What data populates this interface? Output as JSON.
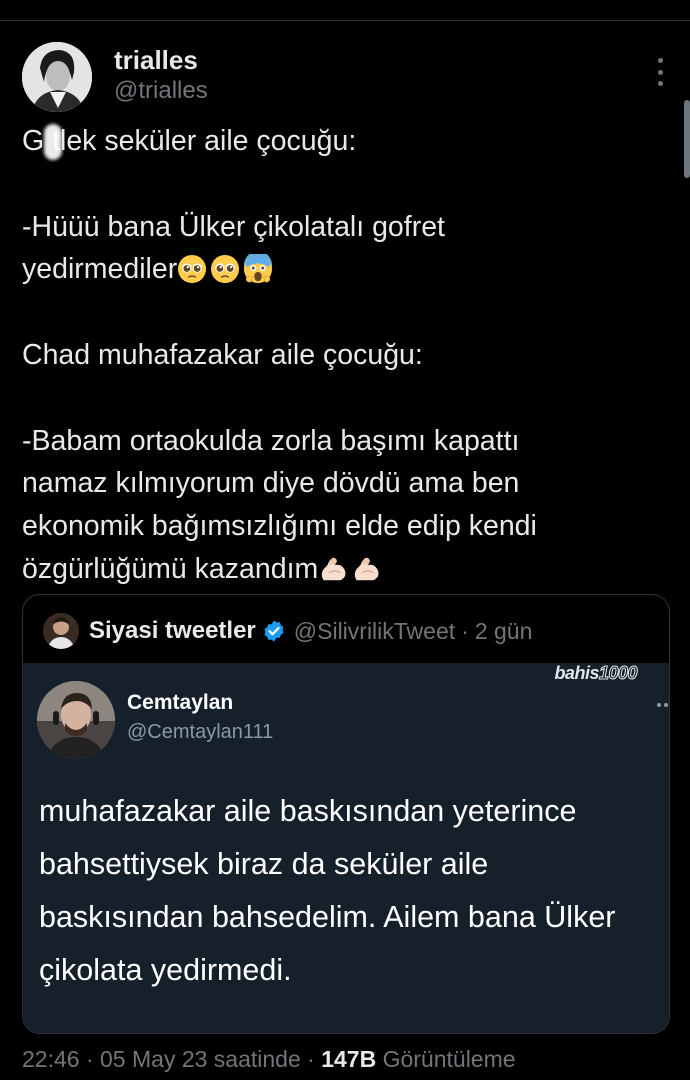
{
  "author": {
    "display_name": "trialles",
    "handle": "@trialles",
    "avatar": "avatar-photo"
  },
  "tweet": {
    "text_line1": "G  tlek seküler aile çocuğu:",
    "text_block2": "-Hüüü bana Ülker çikolatalı gofret\nyedirmediler",
    "emoji_after_block2": [
      "pleading-face-emoji",
      "pleading-face-emoji",
      "screaming-face-emoji"
    ],
    "text_line3": "Chad muhafazakar aile çocuğu:",
    "text_block4": "-Babam ortaokulda zorla başımı kapattı\nnamaz kılmıyorum diye dövdü ama ben\nekonomik bağımsızlığımı elde edip kendi\nözgürlüğümü kazandım",
    "emoji_after_block4": [
      "flexed-biceps-emoji",
      "flexed-biceps-emoji"
    ]
  },
  "quote": {
    "display_name": "Siyasi tweetler",
    "verified_icon": "verified-badge-icon",
    "handle": "@SilivrilikTweet",
    "separator": "·",
    "age": "2 gün",
    "screenshot": {
      "watermark_text": "bahis",
      "watermark_num": "1000",
      "name": "Cemtaylan",
      "handle": "@Cemtaylan111",
      "text": "muhafazakar aile baskısından yeterince\nbahsettiysek biraz da seküler aile\nbaskısından bahsedelim. Ailem bana Ülker\nçikolata yedirmedi."
    }
  },
  "footer": {
    "time": "22:46",
    "sep1": "·",
    "date": "05 May 23 saatinde",
    "sep2": "·",
    "views_count": "147B",
    "views_label": "Görüntüleme"
  },
  "colors": {
    "background": "#000000",
    "text": "#e7e9ea",
    "secondary": "#71767b",
    "verified": "#1d9bf0",
    "screenshot_bg": "#15202b"
  }
}
